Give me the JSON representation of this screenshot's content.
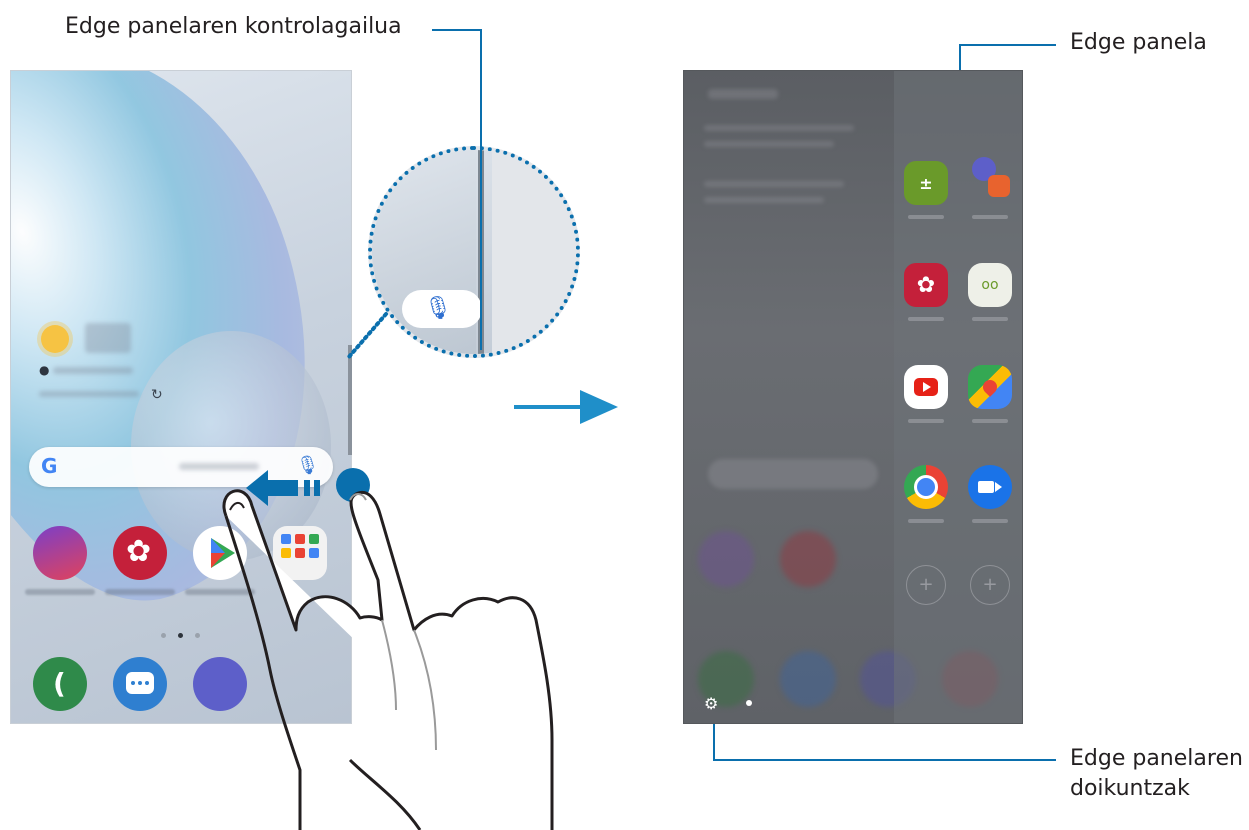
{
  "labels": {
    "edge_handle": "Edge panelaren kontrolagailua",
    "edge_panel": "Edge panela",
    "edge_settings_line1": "Edge panelaren",
    "edge_settings_line2": "doikuntzak"
  },
  "left_phone": {
    "search_logo": "G"
  },
  "colors": {
    "callout_line": "#0a6fad",
    "arrow": "#1f8fc9",
    "touch_dot": "#0a6fad"
  }
}
